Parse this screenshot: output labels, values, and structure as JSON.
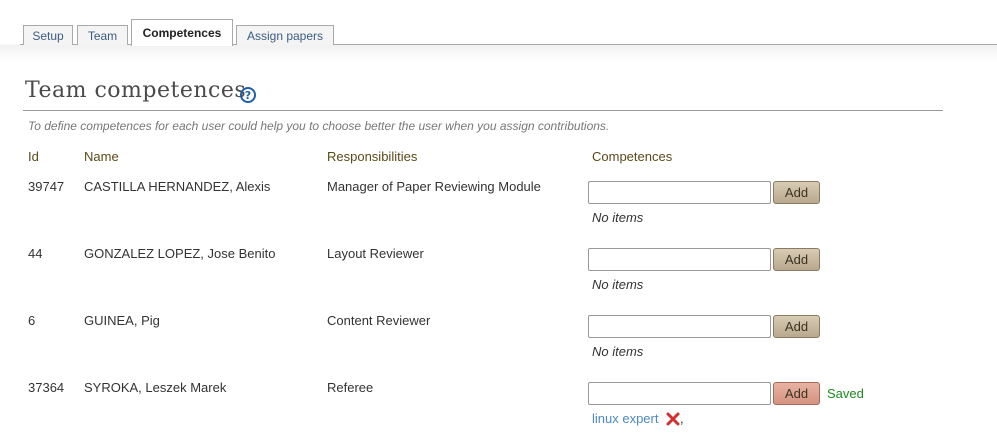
{
  "tabs": [
    {
      "label": "Setup"
    },
    {
      "label": "Team"
    },
    {
      "label": "Competences"
    },
    {
      "label": "Assign papers"
    }
  ],
  "active_tab": "Competences",
  "page": {
    "title": "Team competences",
    "help_glyph": "?",
    "description": "To define competences for each user could help you to choose better the user when you assign contributions."
  },
  "table": {
    "headers": {
      "id": "Id",
      "name": "Name",
      "responsibilities": "Responsibilities",
      "competences": "Competences"
    },
    "rows": [
      {
        "id": "39747",
        "name": "CASTILLA HERNANDEZ, Alexis",
        "responsibility": "Manager of Paper Reviewing Module",
        "input_value": "",
        "add_label": "Add",
        "no_items": "No items"
      },
      {
        "id": "44",
        "name": "GONZALEZ LOPEZ, Jose Benito",
        "responsibility": "Layout Reviewer",
        "input_value": "",
        "add_label": "Add",
        "no_items": "No items"
      },
      {
        "id": "6",
        "name": "GUINEA, Pig",
        "responsibility": "Content Reviewer",
        "input_value": "",
        "add_label": "Add",
        "no_items": "No items"
      },
      {
        "id": "37364",
        "name": "SYROKA, Leszek Marek",
        "responsibility": "Referee",
        "input_value": "",
        "add_label": "Add",
        "status": "Saved",
        "competence": "linux expert",
        "separator": ","
      }
    ]
  },
  "colors": {
    "link": "#4a8ac0",
    "saved": "#1c8a1c",
    "remove": "#d03030",
    "header_text": "#5a4a1a"
  },
  "icons": {
    "help": "question-circle-icon",
    "remove": "red-x-icon"
  }
}
